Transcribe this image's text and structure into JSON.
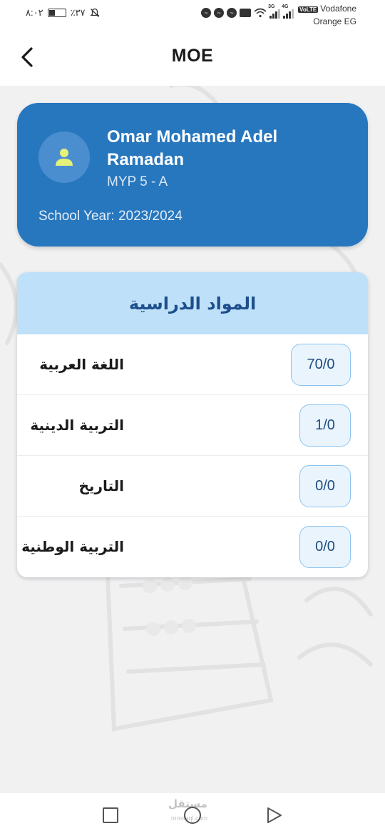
{
  "status_bar": {
    "time": "٨:٠٢",
    "battery": "٪٣٧",
    "battery_level": 0.37,
    "network_1": "3G",
    "network_2": "4G",
    "volte": "VoLTE",
    "carrier_1": "Vodafone",
    "carrier_2": "Orange EG"
  },
  "app_bar": {
    "title": "MOE",
    "back_icon": "chevron-left-icon"
  },
  "student": {
    "name": "Omar Mohamed Adel Ramadan",
    "class": "MYP 5 - A",
    "school_year": "School Year: 2023/2024",
    "avatar_icon": "person-icon",
    "card_color": "#2777be",
    "avatar_icon_color": "#e6f17a"
  },
  "subjects": {
    "header": "المواد الدراسية",
    "header_bg": "#bfe0f9",
    "items": [
      {
        "name": "اللغة العربية",
        "grade": "70/0"
      },
      {
        "name": "التربية الدينية",
        "grade": "1/0"
      },
      {
        "name": "التاريخ",
        "grade": "0/0"
      },
      {
        "name": "التربية الوطنية",
        "grade": "0/0"
      }
    ]
  },
  "nav_bar": {
    "recent_icon": "square-icon",
    "home_icon": "circle-icon",
    "back_icon": "triangle-back-icon"
  },
  "watermark": {
    "text": "مستقل",
    "sub": "mostaql.com"
  }
}
